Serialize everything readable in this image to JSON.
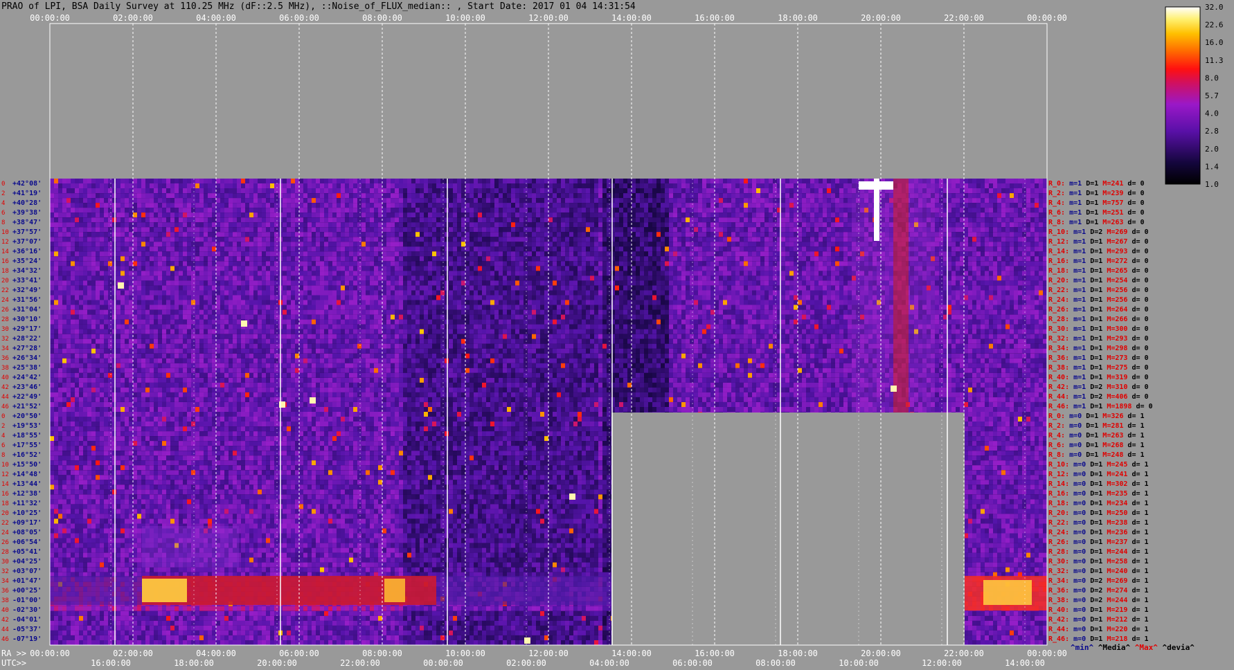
{
  "title": "PRAO of LPI, BSA Daily Survey at 110.25 MHz (dF::2.5 MHz), ::Noise_of_FLUX_median:: , Start Date: 2017 01 04 14:31:54",
  "chart_data": {
    "type": "heatmap",
    "top_axis_ticks": [
      "00:00:00",
      "02:00:00",
      "04:00:00",
      "06:00:00",
      "08:00:00",
      "10:00:00",
      "12:00:00",
      "14:00:00",
      "16:00:00",
      "18:00:00",
      "20:00:00",
      "22:00:00",
      "00:00:00"
    ],
    "ra_label": "RA >>",
    "ra_ticks": [
      "00:00:00",
      "02:00:00",
      "04:00:00",
      "06:00:00",
      "08:00:00",
      "10:00:00",
      "12:00:00",
      "14:00:00",
      "16:00:00",
      "18:00:00",
      "20:00:00",
      "22:00:00",
      "00:00:00"
    ],
    "utc_label": "UTC>>",
    "utc_ticks": [
      "16:00:00",
      "18:00:00",
      "20:00:00",
      "22:00:00",
      "00:00:00",
      "02:00:00",
      "04:00:00",
      "06:00:00",
      "08:00:00",
      "10:00:00",
      "12:00:00",
      "14:00:00"
    ],
    "declinations": [
      "+42°08'",
      "+41°19'",
      "+40°28'",
      "+39°38'",
      "+38°47'",
      "+37°57'",
      "+37°07'",
      "+36°16'",
      "+35°24'",
      "+34°32'",
      "+33°41'",
      "+32°49'",
      "+31°56'",
      "+31°04'",
      "+30°10'",
      "+29°17'",
      "+28°22'",
      "+27°28'",
      "+26°34'",
      "+25°38'",
      "+24°42'",
      "+23°46'",
      "+22°49'",
      "+21°52'",
      "+20°50'",
      "+19°53'",
      "+18°55'",
      "+17°55'",
      "+16°52'",
      "+15°50'",
      "+14°48'",
      "+13°44'",
      "+12°38'",
      "+11°32'",
      "+10°25'",
      "+09°17'",
      "+08°05'",
      "+06°54'",
      "+05°41'",
      "+04°25'",
      "+03°07'",
      "+01°47'",
      "+00°25'",
      "-01°00'",
      "-02°30'",
      "-04°01'",
      "-05°37'",
      "-07°19'"
    ],
    "row_numbers": [
      "0",
      "2",
      "4",
      "6",
      "8",
      "10",
      "12",
      "14",
      "16",
      "18",
      "20",
      "22",
      "24",
      "26",
      "28",
      "30",
      "32",
      "34",
      "36",
      "38",
      "40",
      "42",
      "44",
      "46",
      "0",
      "2",
      "4",
      "6",
      "8",
      "10",
      "12",
      "14",
      "16",
      "18",
      "20",
      "22",
      "24",
      "26",
      "28",
      "30",
      "32",
      "34",
      "36",
      "38",
      "40",
      "42",
      "44",
      "46"
    ],
    "colorbar_ticks": [
      "32.0",
      "22.6",
      "16.0",
      "11.3",
      "8.0",
      "5.7",
      "4.0",
      "2.8",
      "2.0",
      "1.4",
      "1.0"
    ],
    "stats_legend": {
      "min": "^min^",
      "median": "^Media^",
      "max": "^Max^",
      "dev": "^devia^"
    },
    "stats_rows": [
      {
        "r": "R_0:",
        "m": "m=1",
        "D": "D=1",
        "M": "M=241",
        "d": "d= 0"
      },
      {
        "r": "R_2:",
        "m": "m=1",
        "D": "D=1",
        "M": "M=239",
        "d": "d= 0"
      },
      {
        "r": "R_4:",
        "m": "m=1",
        "D": "D=1",
        "M": "M=757",
        "d": "d= 0"
      },
      {
        "r": "R_6:",
        "m": "m=1",
        "D": "D=1",
        "M": "M=251",
        "d": "d= 0"
      },
      {
        "r": "R_8:",
        "m": "m=1",
        "D": "D=1",
        "M": "M=263",
        "d": "d= 0"
      },
      {
        "r": "R_10:",
        "m": "m=1",
        "D": "D=2",
        "M": "M=269",
        "d": "d= 0"
      },
      {
        "r": "R_12:",
        "m": "m=1",
        "D": "D=1",
        "M": "M=267",
        "d": "d= 0"
      },
      {
        "r": "R_14:",
        "m": "m=1",
        "D": "D=1",
        "M": "M=293",
        "d": "d= 0"
      },
      {
        "r": "R_16:",
        "m": "m=1",
        "D": "D=1",
        "M": "M=272",
        "d": "d= 0"
      },
      {
        "r": "R_18:",
        "m": "m=1",
        "D": "D=1",
        "M": "M=265",
        "d": "d= 0"
      },
      {
        "r": "R_20:",
        "m": "m=1",
        "D": "D=1",
        "M": "M=254",
        "d": "d= 0"
      },
      {
        "r": "R_22:",
        "m": "m=1",
        "D": "D=1",
        "M": "M=256",
        "d": "d= 0"
      },
      {
        "r": "R_24:",
        "m": "m=1",
        "D": "D=1",
        "M": "M=256",
        "d": "d= 0"
      },
      {
        "r": "R_26:",
        "m": "m=1",
        "D": "D=1",
        "M": "M=264",
        "d": "d= 0"
      },
      {
        "r": "R_28:",
        "m": "m=1",
        "D": "D=1",
        "M": "M=266",
        "d": "d= 0"
      },
      {
        "r": "R_30:",
        "m": "m=1",
        "D": "D=1",
        "M": "M=300",
        "d": "d= 0"
      },
      {
        "r": "R_32:",
        "m": "m=1",
        "D": "D=1",
        "M": "M=293",
        "d": "d= 0"
      },
      {
        "r": "R_34:",
        "m": "m=1",
        "D": "D=1",
        "M": "M=298",
        "d": "d= 0"
      },
      {
        "r": "R_36:",
        "m": "m=1",
        "D": "D=1",
        "M": "M=273",
        "d": "d= 0"
      },
      {
        "r": "R_38:",
        "m": "m=1",
        "D": "D=1",
        "M": "M=275",
        "d": "d= 0"
      },
      {
        "r": "R_40:",
        "m": "m=1",
        "D": "D=1",
        "M": "M=319",
        "d": "d= 0"
      },
      {
        "r": "R_42:",
        "m": "m=1",
        "D": "D=2",
        "M": "M=310",
        "d": "d= 0"
      },
      {
        "r": "R_44:",
        "m": "m=1",
        "D": "D=2",
        "M": "M=406",
        "d": "d= 0"
      },
      {
        "r": "R_46:",
        "m": "m=1",
        "D": "D=1",
        "M": "M=1898",
        "d": "d= 0"
      },
      {
        "r": "R_0:",
        "m": "m=0",
        "D": "D=1",
        "M": "M=326",
        "d": "d= 1"
      },
      {
        "r": "R_2:",
        "m": "m=0",
        "D": "D=1",
        "M": "M=281",
        "d": "d= 1"
      },
      {
        "r": "R_4:",
        "m": "m=0",
        "D": "D=1",
        "M": "M=263",
        "d": "d= 1"
      },
      {
        "r": "R_6:",
        "m": "m=0",
        "D": "D=1",
        "M": "M=268",
        "d": "d= 1"
      },
      {
        "r": "R_8:",
        "m": "m=0",
        "D": "D=1",
        "M": "M=248",
        "d": "d= 1"
      },
      {
        "r": "R_10:",
        "m": "m=0",
        "D": "D=1",
        "M": "M=245",
        "d": "d= 1"
      },
      {
        "r": "R_12:",
        "m": "m=0",
        "D": "D=1",
        "M": "M=241",
        "d": "d= 1"
      },
      {
        "r": "R_14:",
        "m": "m=0",
        "D": "D=1",
        "M": "M=302",
        "d": "d= 1"
      },
      {
        "r": "R_16:",
        "m": "m=0",
        "D": "D=1",
        "M": "M=235",
        "d": "d= 1"
      },
      {
        "r": "R_18:",
        "m": "m=0",
        "D": "D=1",
        "M": "M=234",
        "d": "d= 1"
      },
      {
        "r": "R_20:",
        "m": "m=0",
        "D": "D=1",
        "M": "M=250",
        "d": "d= 1"
      },
      {
        "r": "R_22:",
        "m": "m=0",
        "D": "D=1",
        "M": "M=238",
        "d": "d= 1"
      },
      {
        "r": "R_24:",
        "m": "m=0",
        "D": "D=1",
        "M": "M=236",
        "d": "d= 1"
      },
      {
        "r": "R_26:",
        "m": "m=0",
        "D": "D=1",
        "M": "M=237",
        "d": "d= 1"
      },
      {
        "r": "R_28:",
        "m": "m=0",
        "D": "D=1",
        "M": "M=244",
        "d": "d= 1"
      },
      {
        "r": "R_30:",
        "m": "m=0",
        "D": "D=1",
        "M": "M=258",
        "d": "d= 1"
      },
      {
        "r": "R_32:",
        "m": "m=0",
        "D": "D=1",
        "M": "M=240",
        "d": "d= 1"
      },
      {
        "r": "R_34:",
        "m": "m=0",
        "D": "D=2",
        "M": "M=269",
        "d": "d= 1"
      },
      {
        "r": "R_36:",
        "m": "m=0",
        "D": "D=2",
        "M": "M=274",
        "d": "d= 1"
      },
      {
        "r": "R_38:",
        "m": "m=0",
        "D": "D=2",
        "M": "M=244",
        "d": "d= 1"
      },
      {
        "r": "R_40:",
        "m": "m=0",
        "D": "D=1",
        "M": "M=219",
        "d": "d= 1"
      },
      {
        "r": "R_42:",
        "m": "m=0",
        "D": "D=1",
        "M": "M=212",
        "d": "d= 1"
      },
      {
        "r": "R_44:",
        "m": "m=0",
        "D": "D=1",
        "M": "M=220",
        "d": "d= 1"
      },
      {
        "r": "R_46:",
        "m": "m=0",
        "D": "D=1",
        "M": "M=218",
        "d": "d= 1"
      }
    ],
    "colors": {
      "background": "#999999",
      "grid": "#ffffff",
      "decl_label": "#0a0a8c",
      "row_number": "#e00000",
      "stat_label": "#e00000",
      "stat_min": "#0a0a8c",
      "stat_max": "#e00000"
    }
  }
}
